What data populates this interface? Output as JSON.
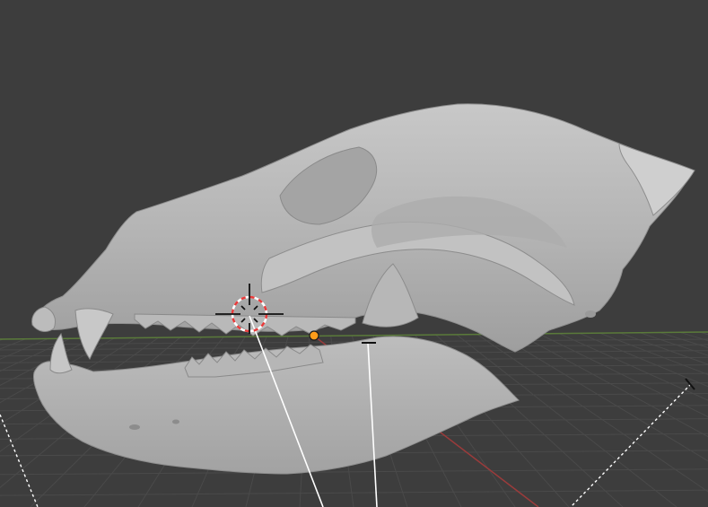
{
  "viewport": {
    "kind": "3d-viewport",
    "background_color": "#3d3d3d",
    "grid_color": "#4a4a4a",
    "grid_enabled": true,
    "x_axis_color": "#9b3b3b",
    "y_axis_color": "#5a7a3a",
    "mesh_color": "#b9b9b9",
    "object_origin_color": "#ff9c1a",
    "cursor_colors": [
      "#e83a3a",
      "#ffffff"
    ],
    "view": "perspective"
  },
  "scene_object": {
    "subject": "animal-skull-mesh",
    "selected": true
  },
  "overlays": {
    "cursor_icon": "3d-cursor-icon",
    "origin_icon": "object-origin-icon",
    "guides": [
      "measure-line",
      "dashed-guide-left",
      "dashed-guide-right"
    ]
  }
}
